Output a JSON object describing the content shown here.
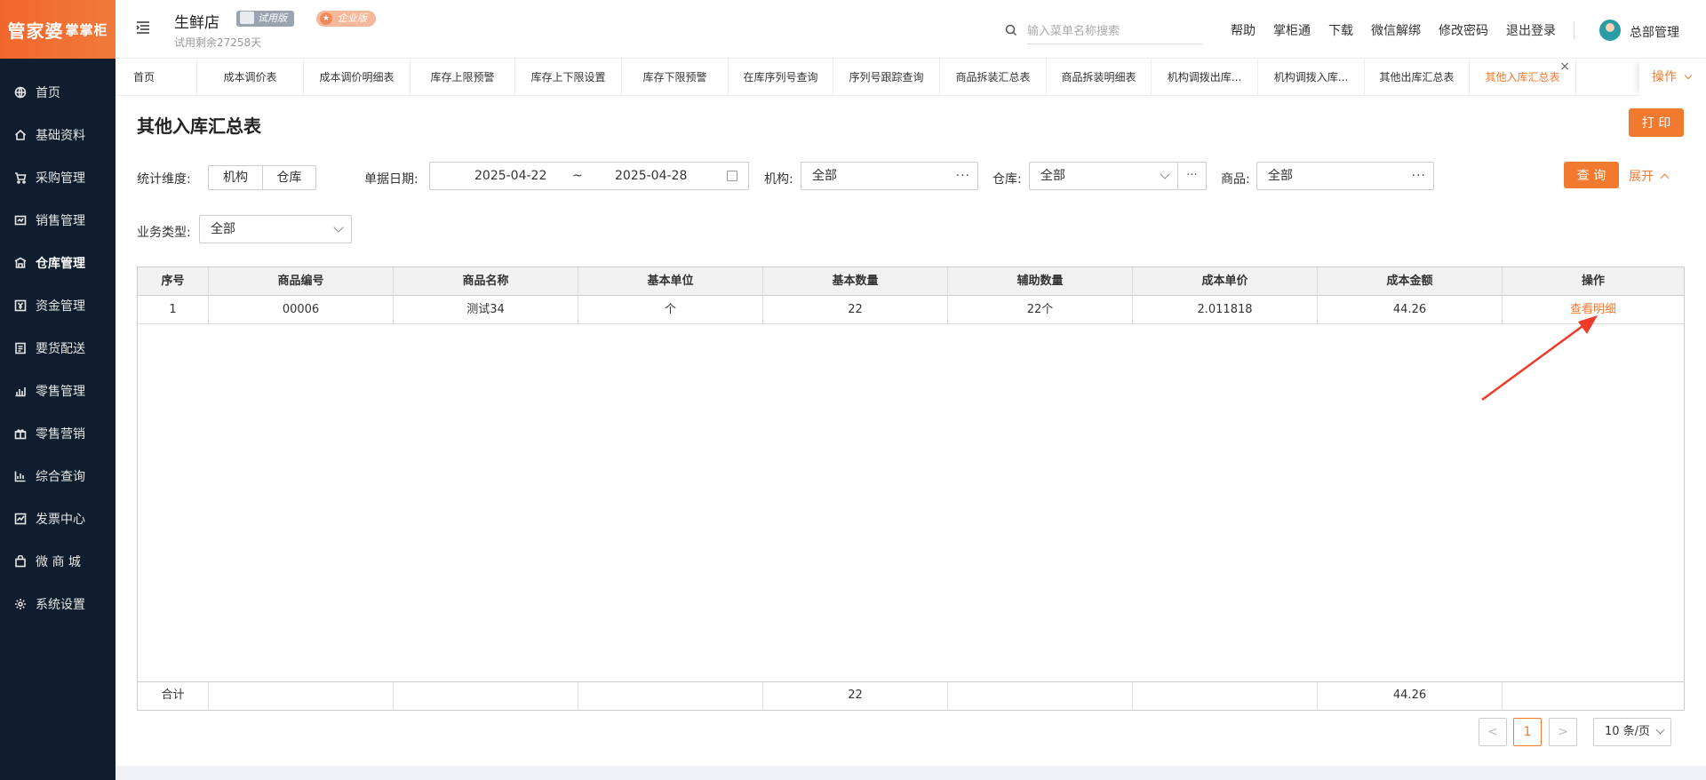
{
  "sidebar": {
    "logo": "管家婆",
    "logo_small": "掌掌柜",
    "items": [
      {
        "label": "首页",
        "icon": "globe-icon"
      },
      {
        "label": "基础资料",
        "icon": "home-icon"
      },
      {
        "label": "采购管理",
        "icon": "cart-icon"
      },
      {
        "label": "销售管理",
        "icon": "sales-icon"
      },
      {
        "label": "仓库管理",
        "icon": "warehouse-icon"
      },
      {
        "label": "资金管理",
        "icon": "money-icon"
      },
      {
        "label": "要货配送",
        "icon": "delivery-icon"
      },
      {
        "label": "零售管理",
        "icon": "retail-icon"
      },
      {
        "label": "零售营销",
        "icon": "gift-icon"
      },
      {
        "label": "综合查询",
        "icon": "chart-icon"
      },
      {
        "label": "发票中心",
        "icon": "invoice-icon"
      },
      {
        "label": "微 商 城",
        "icon": "bag-icon"
      },
      {
        "label": "系统设置",
        "icon": "gear-icon"
      }
    ],
    "active_index": 4
  },
  "header": {
    "store_name": "生鲜店",
    "trial_badge": "试用版",
    "edition_badge": "企业版",
    "trial_left": "试用剩余27258天",
    "search_placeholder": "输入菜单名称搜索",
    "links": [
      "帮助",
      "掌柜通",
      "下载",
      "微信解绑",
      "修改密码",
      "退出登录"
    ],
    "user": "总部管理"
  },
  "tabs": {
    "items": [
      "首页",
      "成本调价表",
      "成本调价明细表",
      "库存上限预警",
      "库存上下限设置",
      "库存下限预警",
      "在库序列号查询",
      "序列号跟踪查询",
      "商品拆装汇总表",
      "商品拆装明细表",
      "机构调拨出库...",
      "机构调拨入库...",
      "其他出库汇总表",
      "其他入库汇总表"
    ],
    "active_index": 13,
    "ops": "操作"
  },
  "page": {
    "title": "其他入库汇总表",
    "print": "打 印",
    "query": "查 询",
    "expand": "展开",
    "filters": {
      "dimension_label": "统计维度:",
      "dimension_options": [
        "机构",
        "仓库"
      ],
      "date_label": "单据日期:",
      "date_start": "2025-04-22",
      "date_sep": "~",
      "date_end": "2025-04-28",
      "org_label": "机构:",
      "org_value": "全部",
      "warehouse_label": "仓库:",
      "warehouse_value": "全部",
      "product_label": "商品:",
      "product_value": "全部",
      "biz_type_label": "业务类型:",
      "biz_type_value": "全部"
    }
  },
  "table": {
    "columns": [
      "序号",
      "商品编号",
      "商品名称",
      "基本单位",
      "基本数量",
      "辅助数量",
      "成本单价",
      "成本金额",
      "操作"
    ],
    "rows": [
      [
        "1",
        "00006",
        "测试34",
        "个",
        "22",
        "22个",
        "2.011818",
        "44.26",
        "查看明细"
      ]
    ],
    "footer": [
      "合计",
      "",
      "",
      "",
      "22",
      "",
      "",
      "44.26",
      ""
    ]
  },
  "pagination": {
    "prev": "<",
    "current": "1",
    "next": ">",
    "page_size": "10 条/页"
  },
  "colors": {
    "accent": "#f27a2e",
    "sidebar_bg": "#0f1d2e",
    "annotation_arrow": "#ee3b2a"
  }
}
